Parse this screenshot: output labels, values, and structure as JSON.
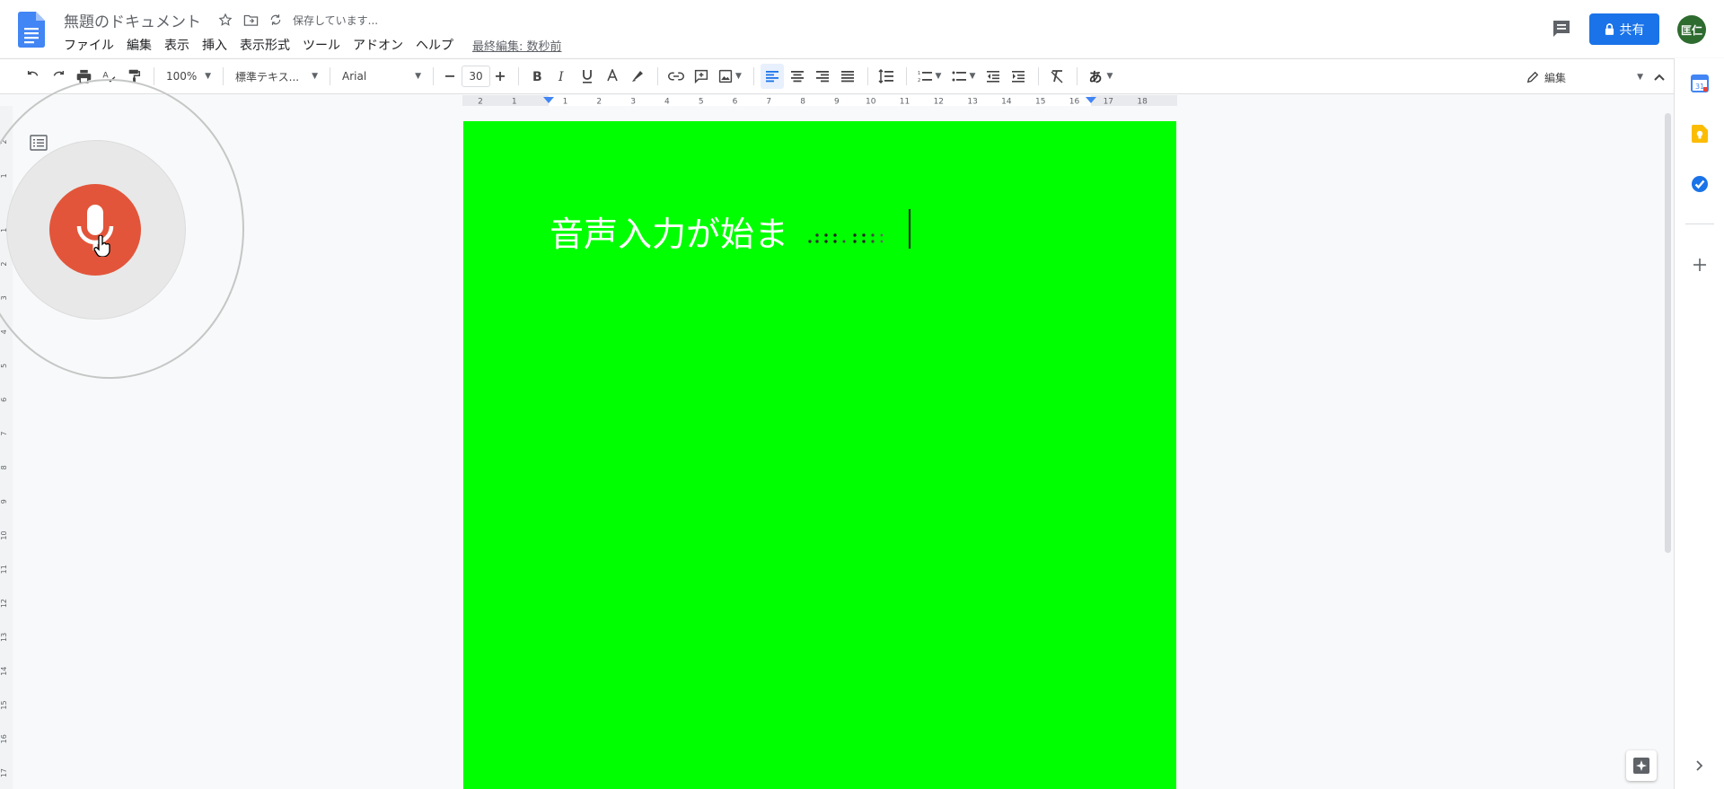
{
  "header": {
    "doc_title": "無題のドキュメント",
    "saving_status": "保存しています...",
    "menu": [
      "ファイル",
      "編集",
      "表示",
      "挿入",
      "表示形式",
      "ツール",
      "アドオン",
      "ヘルプ"
    ],
    "last_edit": "最終編集: 数秒前",
    "share_label": "共有",
    "avatar_initials": "匡仁"
  },
  "toolbar": {
    "zoom": "100%",
    "style": "標準テキス...",
    "font": "Arial",
    "font_size": "30",
    "input_tools_label": "あ",
    "mode_label": "編集"
  },
  "ruler": {
    "h_labels": [
      "2",
      "1",
      "1",
      "2",
      "3",
      "4",
      "5",
      "6",
      "7",
      "8",
      "9",
      "10",
      "11",
      "12",
      "13",
      "14",
      "15",
      "16",
      "17",
      "18"
    ],
    "v_labels": [
      "2",
      "1",
      "1",
      "2",
      "3",
      "4",
      "5",
      "6",
      "7",
      "8",
      "9",
      "10",
      "11",
      "12",
      "13",
      "14",
      "15",
      "16",
      "17"
    ]
  },
  "document": {
    "body_text": "音声入力が始ま",
    "page_color": "#00ff00",
    "text_color": "#ffffff"
  },
  "voice_typing": {
    "mic_color": "#e2553a",
    "state": "listening"
  },
  "side_panel": {
    "calendar_label": "31"
  }
}
